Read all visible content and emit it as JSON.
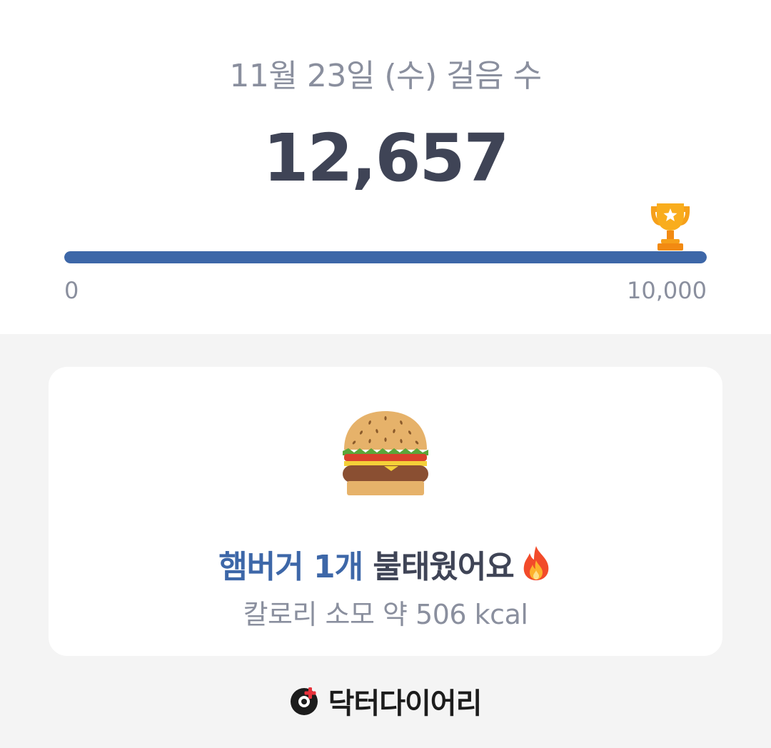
{
  "header": {
    "date_label": "11월 23일 (수) 걸음 수",
    "step_count": "12,657"
  },
  "progress": {
    "min_label": "0",
    "max_label": "10,000",
    "fill_fraction": 1.0,
    "goal_reached": true,
    "bar_color": "#3d67a8",
    "goal_icon": "trophy-icon"
  },
  "card": {
    "food_icon": "hamburger-icon",
    "highlight": "햄버거 1개",
    "rest": " 불태웠어요",
    "fire_icon": "fire-icon",
    "calorie_text": "칼로리 소모 약 506 kcal"
  },
  "footer": {
    "brand_name": "닥터다이어리",
    "logo_icon": "doctor-diary-logo-icon",
    "logo_accent": "#e8313b"
  }
}
